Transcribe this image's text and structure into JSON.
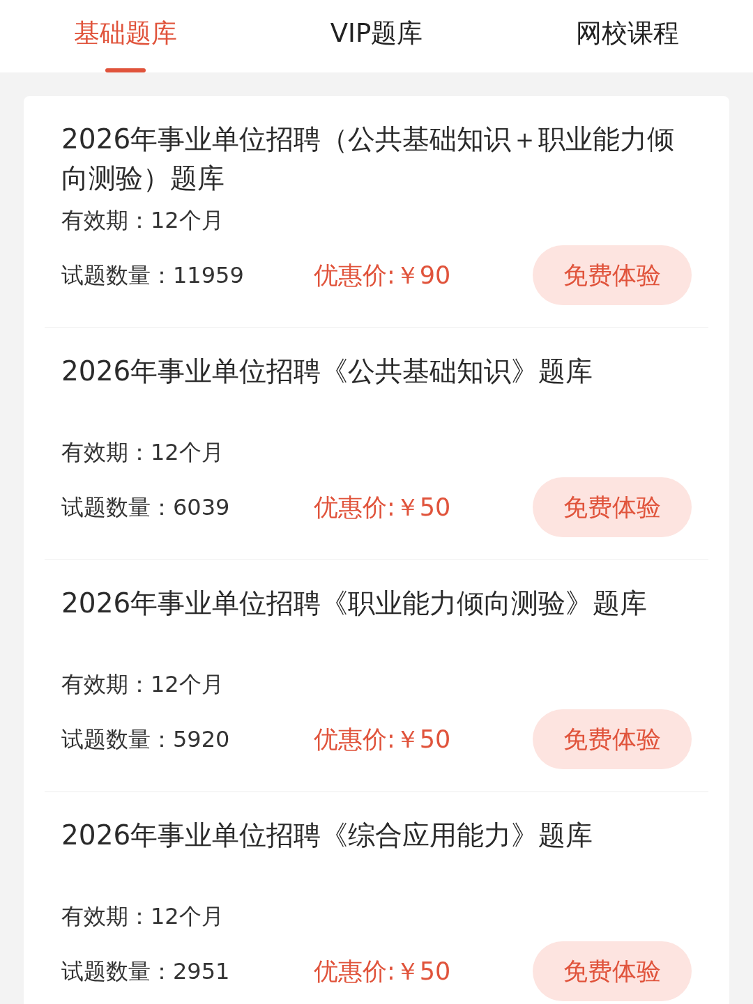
{
  "tabs": [
    {
      "label": "基础题库",
      "selected": true
    },
    {
      "label": "VIP题库",
      "selected": false
    },
    {
      "label": "网校课程",
      "selected": false
    }
  ],
  "items": [
    {
      "title": "2026年事业单位招聘（公共基础知识＋职业能力倾向测验）题库",
      "validity": "有效期：12个月",
      "count": "试题数量：11959",
      "price": "优惠价:￥90",
      "button": "免费体验"
    },
    {
      "title": "2026年事业单位招聘《公共基础知识》题库",
      "validity": "有效期：12个月",
      "count": "试题数量：6039",
      "price": "优惠价:￥50",
      "button": "免费体验"
    },
    {
      "title": "2026年事业单位招聘《职业能力倾向测验》题库",
      "validity": "有效期：12个月",
      "count": "试题数量：5920",
      "price": "优惠价:￥50",
      "button": "免费体验"
    },
    {
      "title": "2026年事业单位招聘《综合应用能力》题库",
      "validity": "有效期：12个月",
      "count": "试题数量：2951",
      "price": "优惠价:￥50",
      "button": "免费体验"
    }
  ]
}
